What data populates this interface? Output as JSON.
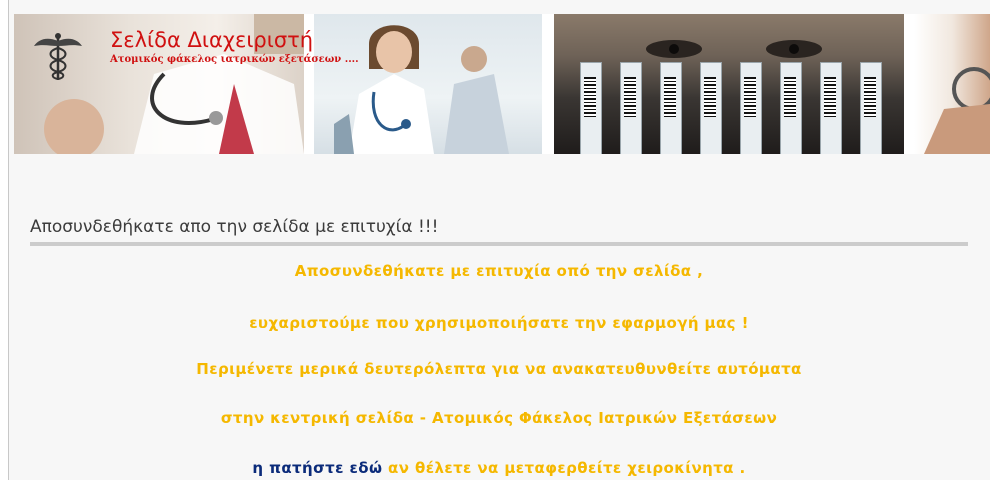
{
  "header": {
    "title": "Σελίδα Διαχειριστή",
    "subtitle": "Ατομικός φάκελος ιατρικών εξετάσεων ...."
  },
  "main": {
    "heading": "Αποσυνδεθήκατε απο την σελίδα με επιτυχία !!!",
    "messages": [
      "Αποσυνδεθήκατε με επιτυχία οπό την σελίδα ,",
      "ευχαριστούμε που χρησιμοποιήσατε την εφαρμογή μας !",
      "Περιμένετε μερικά δευτερόλεπτα για να ανακατευθυνθείτε αυτόματα",
      "στην κεντρική σελίδα - Ατομικός Φάκελος Ιατρικών Εξετάσεων"
    ],
    "manual_link": "η πατήστε εδώ",
    "manual_text": " αν θέλετε να μεταφερθείτε χειροκίνητα ."
  },
  "icons": {
    "logo": "caduceus-icon"
  },
  "colors": {
    "title": "#d01010",
    "message": "#f5b800",
    "link": "#0b2b7a",
    "heading": "#3b3b3b",
    "rule": "#cccccc"
  }
}
